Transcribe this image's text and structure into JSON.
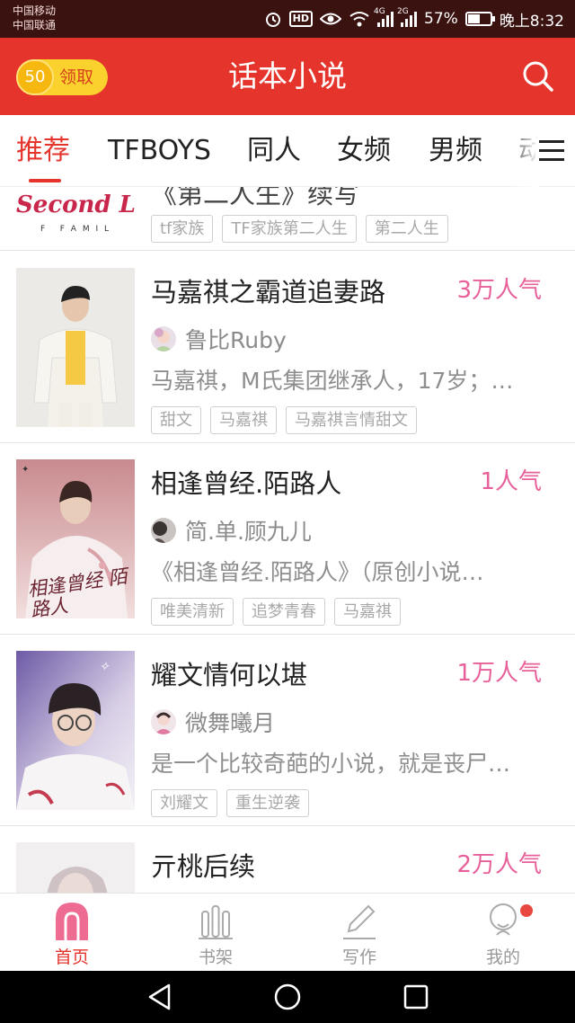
{
  "status_bar": {
    "carrier_1": "中国移动",
    "carrier_2": "中国联通",
    "hd_badge": "HD",
    "net_1": "4G",
    "net_2": "2G",
    "battery_percent": "57%",
    "battery_level": 0.57,
    "time": "晚上8:32",
    "icons": [
      "alarm-icon",
      "eye-icon",
      "wifi-icon",
      "signal-icon",
      "battery-icon"
    ]
  },
  "header": {
    "coin_amount": "50",
    "coin_label": "领取",
    "title": "话本小说",
    "icon": "search-icon",
    "colors": {
      "brand": "#e5342c",
      "coin": "#fbd12e"
    }
  },
  "tabs": {
    "items": [
      "推荐",
      "TFBOYS",
      "同人",
      "女频",
      "男频",
      "动"
    ],
    "active_index": 0,
    "menu_icon": "menu-icon"
  },
  "partial_book": {
    "cover_text": "Second Life",
    "cover_subtext": "F   F A M I L",
    "title_fragment": "《第二人生》续写",
    "tags": [
      "tf家族",
      "TF家族第二人生",
      "第二人生"
    ]
  },
  "books": [
    {
      "title": "马嘉祺之霸道追妻路",
      "popularity": "3万人气",
      "author": "鲁比Ruby",
      "synopsis": "马嘉祺，M氏集团继承人，17岁；…",
      "tags": [
        "甜文",
        "马嘉祺",
        "马嘉祺言情甜文"
      ]
    },
    {
      "title": "相逢曾经.陌路人",
      "popularity": "1人气",
      "author": "简.单.顾九儿",
      "synopsis": "《相逢曾经.陌路人》（原创小说…",
      "tags": [
        "唯美清新",
        "追梦青春",
        "马嘉祺"
      ],
      "cover_text": "相逢曾经 陌路人"
    },
    {
      "title": "耀文情何以堪",
      "popularity": "1万人气",
      "author": "微舞曦月",
      "synopsis": "是一个比较奇葩的小说，就是丧尸…",
      "tags": [
        "刘耀文",
        "重生逆袭"
      ]
    },
    {
      "title": "亓桃后续",
      "popularity": "2万人气"
    }
  ],
  "bottom_nav": {
    "items": [
      {
        "label": "首页",
        "icon": "home-icon"
      },
      {
        "label": "书架",
        "icon": "bookshelf-icon"
      },
      {
        "label": "写作",
        "icon": "pencil-icon"
      },
      {
        "label": "我的",
        "icon": "profile-icon"
      }
    ],
    "active_index": 0
  },
  "system_nav": {
    "icons": [
      "back-icon",
      "home-circle-icon",
      "recents-icon"
    ]
  }
}
